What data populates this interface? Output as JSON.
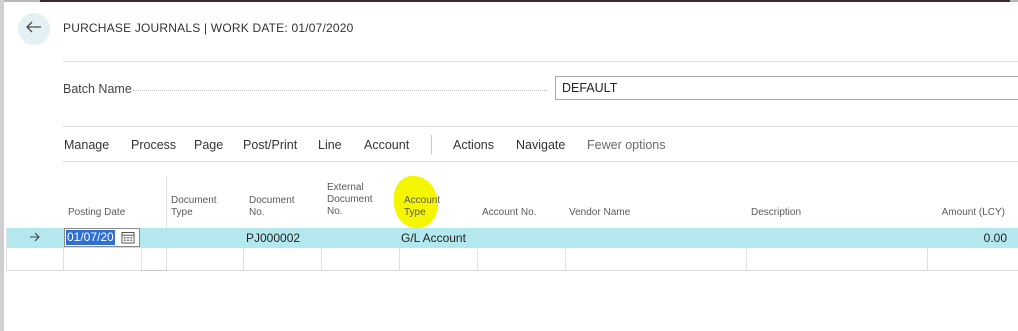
{
  "header": {
    "title": "PURCHASE JOURNALS | WORK DATE: 01/07/2020",
    "back_icon": "arrow-left-icon"
  },
  "batch": {
    "label": "Batch Name",
    "value": "DEFAULT"
  },
  "menu": {
    "items": [
      "Manage",
      "Process",
      "Page",
      "Post/Print",
      "Line",
      "Account"
    ],
    "secondary": [
      "Actions",
      "Navigate"
    ],
    "fewer_options": "Fewer options"
  },
  "table": {
    "headers": {
      "posting_date": "Posting Date",
      "document_type": "Document Type",
      "document_no": "Document No.",
      "external_document_no": "External Document No.",
      "account_type": "Account Type",
      "account_no": "Account No.",
      "vendor_name": "Vendor Name",
      "description": "Description",
      "amount_lcy": "Amount (LCY)"
    },
    "rows": [
      {
        "posting_date": "01/07/20",
        "document_type": "",
        "document_no": "PJ000002",
        "external_document_no": "",
        "account_type": "G/L Account",
        "account_no": "",
        "vendor_name": "",
        "description": "",
        "amount_lcy": "0.00"
      }
    ]
  },
  "colors": {
    "selected_row": "#b3e8ee",
    "highlight_marker": "#f5f500",
    "text_selection": "#2f6fd3"
  }
}
